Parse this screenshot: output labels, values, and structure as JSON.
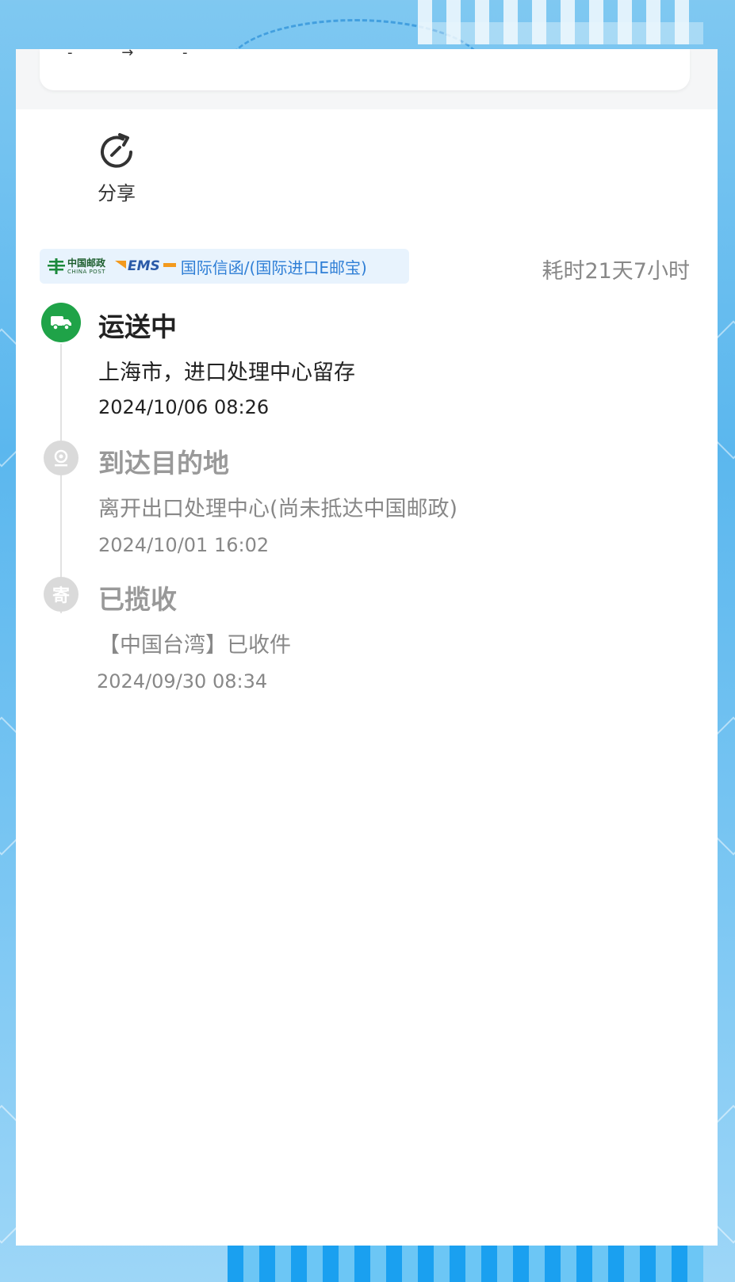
{
  "header_remnant": "- → -",
  "share": {
    "label": "分享",
    "icon": "share-rotate-icon"
  },
  "carrier": {
    "china_post_cn": "中国邮政",
    "china_post_en": "CHINA POST",
    "ems": "EMS",
    "service": "国际信函/(国际进口E邮宝)"
  },
  "duration": "耗时21天7小时",
  "timeline": [
    {
      "status": "运送中",
      "desc": "上海市，进口处理中心留存",
      "time": "2024/10/06 08:26",
      "icon": "truck-icon",
      "state": "active"
    },
    {
      "status": "到达目的地",
      "desc": "离开出口处理中心(尚未抵达中国邮政)",
      "time": "2024/10/01 16:02",
      "icon": "location-pin-icon",
      "state": "past"
    },
    {
      "status": "已揽收",
      "desc": "【中国台湾】已收件",
      "time": "2024/09/30 08:34",
      "icon": "ji-icon",
      "icon_text": "寄",
      "state": "past"
    }
  ],
  "colors": {
    "active": "#1fa348",
    "inactive": "#dadada",
    "service_text": "#2f7fd6",
    "carrier_bg": "#e8f3fd"
  }
}
